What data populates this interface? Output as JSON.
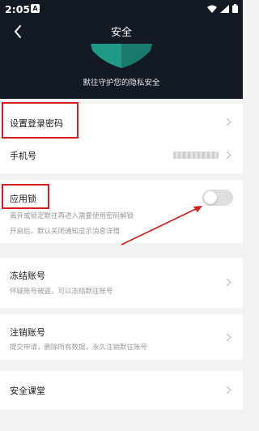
{
  "status_bar": {
    "time": "2:05",
    "notification_badge": "A"
  },
  "header": {
    "title": "安全",
    "slogan": "默往守护您的隐私安全"
  },
  "settings": {
    "set_password": {
      "label": "设置登录密码"
    },
    "phone": {
      "label": "手机号"
    },
    "app_lock": {
      "label": "应用锁",
      "description_1": "离开或锁定默往再进入需要使用密码解锁",
      "description_2": "开启后，默认关闭通知显示消息详情",
      "enabled": false
    },
    "freeze": {
      "label": "冻结账号",
      "description": "怀疑账号被盗，可以冻结默往账号"
    },
    "cancel": {
      "label": "注销账号",
      "description": "提交申请，删除所有数据，永久注销默往账号"
    },
    "security_class": {
      "label": "安全课堂"
    }
  },
  "colors": {
    "header_bg": "#141a24",
    "page_bg": "#f2f2f4",
    "shield": "#1f9a87",
    "highlight": "#d61d1d"
  }
}
